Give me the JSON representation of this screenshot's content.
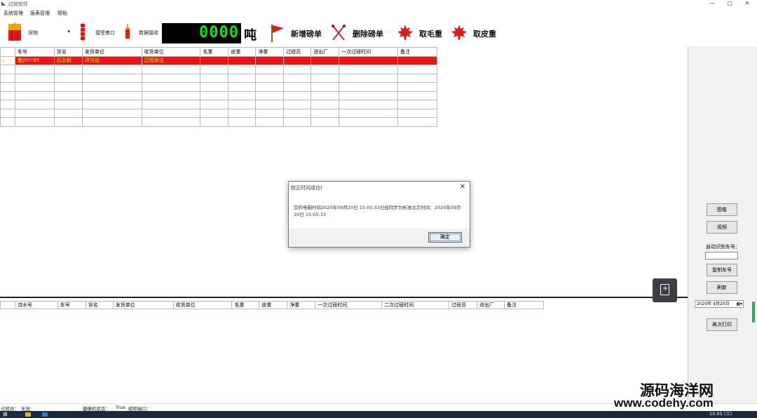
{
  "window": {
    "title": "过磅软件",
    "min": "—",
    "max": "□",
    "close": "✕"
  },
  "menu": [
    "系统管理",
    "报表管理",
    "帮助"
  ],
  "toolbar": {
    "goods_label": "货物",
    "goods_value": "",
    "goods_arrow": "▾",
    "serial_label": "接受串口",
    "data_label": "数据接收",
    "weight_value": "0000",
    "weight_unit": "吨",
    "add_label": "新增磅单",
    "delete_label": "删除磅单",
    "delete_dot": "·",
    "gross_label": "取毛重",
    "tare_label": "取皮重"
  },
  "top_grid": {
    "columns": [
      "车号",
      "货名",
      "发货单位",
      "收货单位",
      "毛重",
      "皮重",
      "净重",
      "过磅员",
      "进出厂",
      "一次过磅时间",
      "备注"
    ],
    "row_marker": "▸",
    "rows": [
      [
        "鲁J90765",
        "石灰粉",
        "洋沟远",
        "辽阳海达",
        "",
        "",
        "",
        "",
        "",
        "",
        ""
      ],
      [
        "",
        "",
        "",
        "",
        "",
        "",
        "",
        "",
        "",
        "",
        ""
      ],
      [
        "",
        "",
        "",
        "",
        "",
        "",
        "",
        "",
        "",
        "",
        ""
      ],
      [
        "",
        "",
        "",
        "",
        "",
        "",
        "",
        "",
        "",
        "",
        ""
      ],
      [
        "",
        "",
        "",
        "",
        "",
        "",
        "",
        "",
        "",
        "",
        ""
      ],
      [
        "",
        "",
        "",
        "",
        "",
        "",
        "",
        "",
        "",
        "",
        ""
      ],
      [
        "",
        "",
        "",
        "",
        "",
        "",
        "",
        "",
        "",
        "",
        ""
      ],
      [
        "",
        "",
        "",
        "",
        "",
        "",
        "",
        "",
        "",
        "",
        ""
      ]
    ]
  },
  "bottom_grid": {
    "columns": [
      "",
      "流水号",
      "车号",
      "货名",
      "发货单位",
      "收货单位",
      "毛重",
      "皮重",
      "净重",
      "一次过磅时间",
      "二次过磅时间",
      "过磅员",
      "进出厂",
      "备注"
    ]
  },
  "right_panel": {
    "photo_label": "图像",
    "video_label": "视频",
    "auto_plate_label": "自动识别车号：",
    "plate_value": "",
    "copy_plate_label": "复制车号",
    "refresh_label": "刷新",
    "date_value": "2020年 9月20日",
    "date_icon": "▦▾",
    "reprint_label": "再次打印"
  },
  "dialog": {
    "title": "校正时间成功!",
    "close": "✕",
    "message": "您的电脑时间2020年09月20日 15:05:33已经同步为标准北京时间：2020年09月20日 15:05:33",
    "ok_label": "确定"
  },
  "status": {
    "operator_label": "过磅员：",
    "operator_value": "无效",
    "printer_label": "摄像机状态：",
    "printer_value": "True",
    "weighbridge_label": "磅称端口："
  },
  "taskbar": {
    "start": "⊞",
    "clock": "15:05 ☐☐"
  },
  "watermark": {
    "cn": "源码海洋网",
    "url": "www.codehy.com"
  },
  "colors": {
    "selected_row": "#f50f0f",
    "selected_text": "#ffe600",
    "display_bg": "#000000",
    "display_digits": "#18e018"
  }
}
